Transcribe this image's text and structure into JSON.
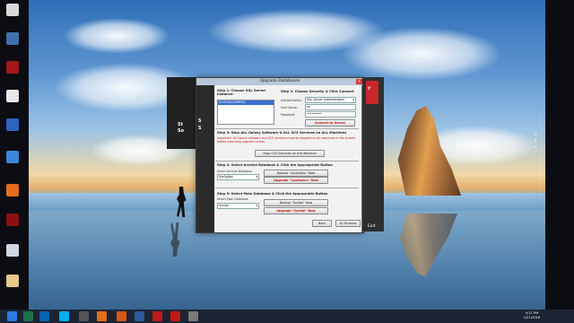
{
  "desktop": {
    "left_text": [
      "St",
      "So"
    ],
    "right_text": [
      "e",
      "1",
      "e"
    ],
    "icons": [
      {
        "name": "pdf-icon",
        "label": "",
        "color": "#d8d8d8"
      },
      {
        "name": "app-icon-blue",
        "label": "",
        "color": "#3f6fb0"
      },
      {
        "name": "app-icon-red",
        "label": "",
        "color": "#a31818"
      },
      {
        "name": "file-icon",
        "label": "",
        "color": "#e8e8e8"
      },
      {
        "name": "document-icon",
        "label": "",
        "color": "#2c64c0"
      },
      {
        "name": "network-icon",
        "label": "",
        "color": "#3b88d8"
      },
      {
        "name": "firefox-icon",
        "label": "",
        "color": "#e56b1f"
      },
      {
        "name": "app-icon-dark-red",
        "label": "",
        "color": "#8a1010"
      },
      {
        "name": "recycle-bin-icon",
        "label": "",
        "color": "#cfd6df"
      },
      {
        "name": "folder-icon",
        "label": "",
        "color": "#e6c88a"
      }
    ]
  },
  "dialog": {
    "title": "Upgrade Databases",
    "close_label": "X",
    "strip_text": [
      "S",
      "S"
    ],
    "logo_letters": "Y",
    "step1": {
      "heading": "Step 1: Choose SQL Server Instance:",
      "selected_instance": "GCSTUU\\GXPRESS"
    },
    "step2": {
      "heading": "Step 2: Choose Security & Click Connect",
      "auth_label": "Authentication:",
      "auth_value": "SQL Server Authentication",
      "user_label": "User Name:",
      "user_value": "sa",
      "password_label": "Password:",
      "password_value": "•••••••••",
      "connect_button": "Connect to Server"
    },
    "step3": {
      "heading": "Step 3: Stop ALL Galaxy Software & ALL GCS Services on ALL Machines",
      "warning": "Important: All Galaxy software and GCS services must be stopped on all machines in the system before executing upgrade scripts.",
      "stop_button": "Stop GCS Services on this Machine"
    },
    "step4": {
      "heading": "Step 4: Select Archive Database & Click the Appropriate Button",
      "select_label": "Select Archive Database",
      "select_value": "SysGalArc",
      "backup_button": "Backup \"SysGalArc\" Now",
      "upgrade_button": "Upgrade \"SysGalArc\" Now"
    },
    "step5": {
      "heading": "Step 5: Select Main Database & Click the Appropriate Button",
      "select_label": "Select Main Database",
      "select_value": "SysGal",
      "backup_button": "Backup \"SysGal\" Now",
      "upgrade_button": "Upgrade \"SysGal\" Now"
    },
    "back_button": "Back",
    "finished_button": "All Finished",
    "exit_label": "Exit"
  },
  "taskbar": {
    "clock_time": "4:11 PM",
    "clock_date": "1/21/2016",
    "items": [
      {
        "name": "windows-start-icon",
        "color": "#2c7be5"
      },
      {
        "name": "excel-icon",
        "color": "#1e7145"
      },
      {
        "name": "outlook-icon",
        "color": "#0a64ad"
      },
      {
        "name": "skype-icon",
        "color": "#00aff0"
      },
      {
        "name": "app-icon",
        "color": "#555555"
      },
      {
        "name": "firefox-icon",
        "color": "#e56b1f"
      },
      {
        "name": "app-icon-orange",
        "color": "#d45a1a"
      },
      {
        "name": "app-icon-blue",
        "color": "#2a5b9c"
      },
      {
        "name": "app-icon-red",
        "color": "#b81c1c"
      },
      {
        "name": "app-icon-red-2",
        "color": "#c01818"
      },
      {
        "name": "app-icon-gray",
        "color": "#7a7a7a"
      }
    ]
  }
}
